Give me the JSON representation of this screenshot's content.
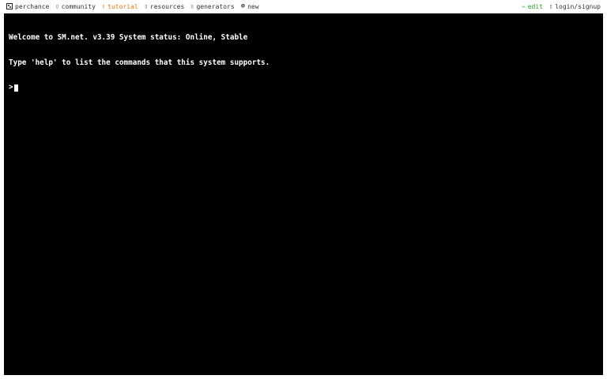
{
  "nav": {
    "logo_icon": "dice-icon",
    "logo_label": "perchance",
    "community_label": "community",
    "tutorial_label": "tutorial",
    "resources_label": "resources",
    "generators_label": "generators",
    "new_label": "new",
    "edit_label": "edit",
    "login_label": "login/signup",
    "accent_color": "#e07a1a",
    "edit_color": "#2a9d2a"
  },
  "terminal": {
    "line1": "Welcome to SM.net. v3.39 System status: Online, Stable",
    "line2": "Type 'help' to list the commands that this system supports.",
    "prompt": ">",
    "background": "#000000",
    "text_color": "#ffffff"
  }
}
